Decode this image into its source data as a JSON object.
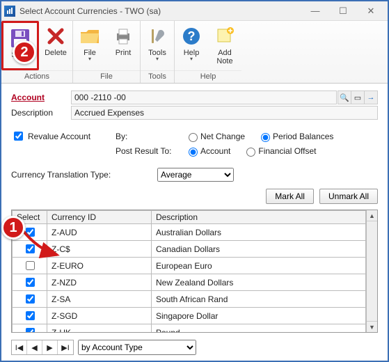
{
  "window": {
    "title": "Select Account Currencies  -  TWO (sa)"
  },
  "ribbon": {
    "save": "Save",
    "delete": "Delete",
    "file": "File",
    "print": "Print",
    "tools": "Tools",
    "help": "Help",
    "addnote": "Add Note",
    "group_actions": "Actions",
    "group_file": "File",
    "group_tools": "Tools",
    "group_help": "Help"
  },
  "fields": {
    "account_label": "Account",
    "account_value": "000 -2110 -00",
    "description_label": "Description",
    "description_value": "Accrued Expenses"
  },
  "options": {
    "revalue_label": "Revalue Account",
    "by_label": "By:",
    "netchange": "Net Change",
    "periodbal": "Period Balances",
    "postresult_label": "Post Result To:",
    "account_opt": "Account",
    "finoffset": "Financial Offset",
    "ctt_label": "Currency Translation Type:",
    "ctt_value": "Average"
  },
  "buttons": {
    "markall": "Mark All",
    "unmarkall": "Unmark All"
  },
  "grid": {
    "headers": {
      "select": "Select",
      "cid": "Currency ID",
      "desc": "Description"
    },
    "rows": [
      {
        "checked": true,
        "cid": "Z-AUD",
        "desc": "Australian Dollars"
      },
      {
        "checked": true,
        "cid": "Z-C$",
        "desc": "Canadian Dollars"
      },
      {
        "checked": false,
        "cid": "Z-EURO",
        "desc": "European Euro"
      },
      {
        "checked": true,
        "cid": "Z-NZD",
        "desc": "New Zealand Dollars"
      },
      {
        "checked": true,
        "cid": "Z-SA",
        "desc": "South African Rand"
      },
      {
        "checked": true,
        "cid": "Z-SGD",
        "desc": "Singapore Dollar"
      },
      {
        "checked": true,
        "cid": "Z-UK",
        "desc": "Pound"
      }
    ]
  },
  "nav": {
    "dropdown": "by Account Type"
  },
  "callouts": {
    "one": "1",
    "two": "2"
  }
}
